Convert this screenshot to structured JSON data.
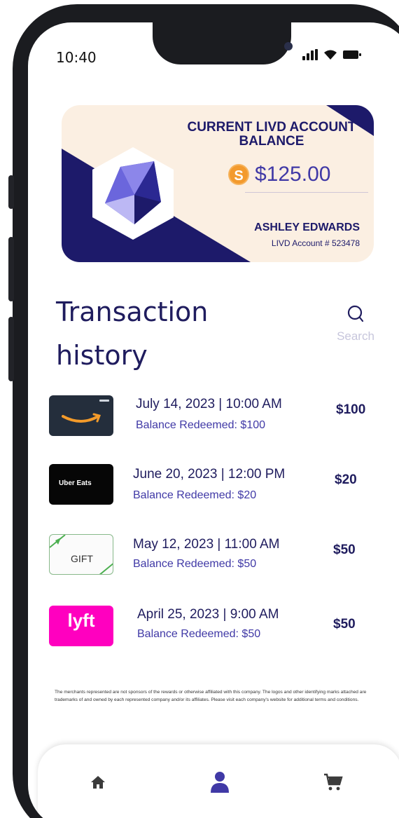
{
  "status_bar": {
    "time": "10:40"
  },
  "balance_card": {
    "title": "CURRENT LIVD ACCOUNT BALANCE",
    "amount": "$125.00",
    "coin_symbol": "S",
    "holder_name": "ASHLEY EDWARDS",
    "account_number": "LIVD Account # 523478"
  },
  "history": {
    "title": "Transaction history",
    "search_label": "Search"
  },
  "transactions": [
    {
      "merchant": "amazon",
      "logo_text": "",
      "date": "July 14, 2023 | 10:00 AM",
      "detail": "Balance Redeemed: $100",
      "amount": "$100"
    },
    {
      "merchant": "uber-eats",
      "logo_text": "Uber Eats",
      "date": "June 20, 2023 | 12:00 PM",
      "detail": "Balance Redeemed: $20",
      "amount": "$20"
    },
    {
      "merchant": "gift",
      "logo_text": "GIFT",
      "date": "May 12, 2023 | 11:00 AM",
      "detail": "Balance Redeemed: $50",
      "amount": "$50"
    },
    {
      "merchant": "lyft",
      "logo_text": "lyft",
      "date": "April 25, 2023 | 9:00 AM",
      "detail": "Balance Redeemed: $50",
      "amount": "$50"
    }
  ],
  "disclaimer": "The merchants represented are not sponsors of the rewards or otherwise affiliated with this company. The logos and other identifying marks attached are trademarks of and owned by each represented company and/or its affiliates. Please visit each company's website for additional terms and conditions.",
  "nav": {
    "items": [
      {
        "icon": "home-icon",
        "active": false
      },
      {
        "icon": "user-icon",
        "active": true
      },
      {
        "icon": "cart-icon",
        "active": false
      }
    ]
  },
  "colors": {
    "navy": "#1d1a6a",
    "accent": "#4039a6",
    "card_bg": "#fbefe2",
    "coin": "#f39a2d",
    "lyft": "#ff00bf"
  }
}
